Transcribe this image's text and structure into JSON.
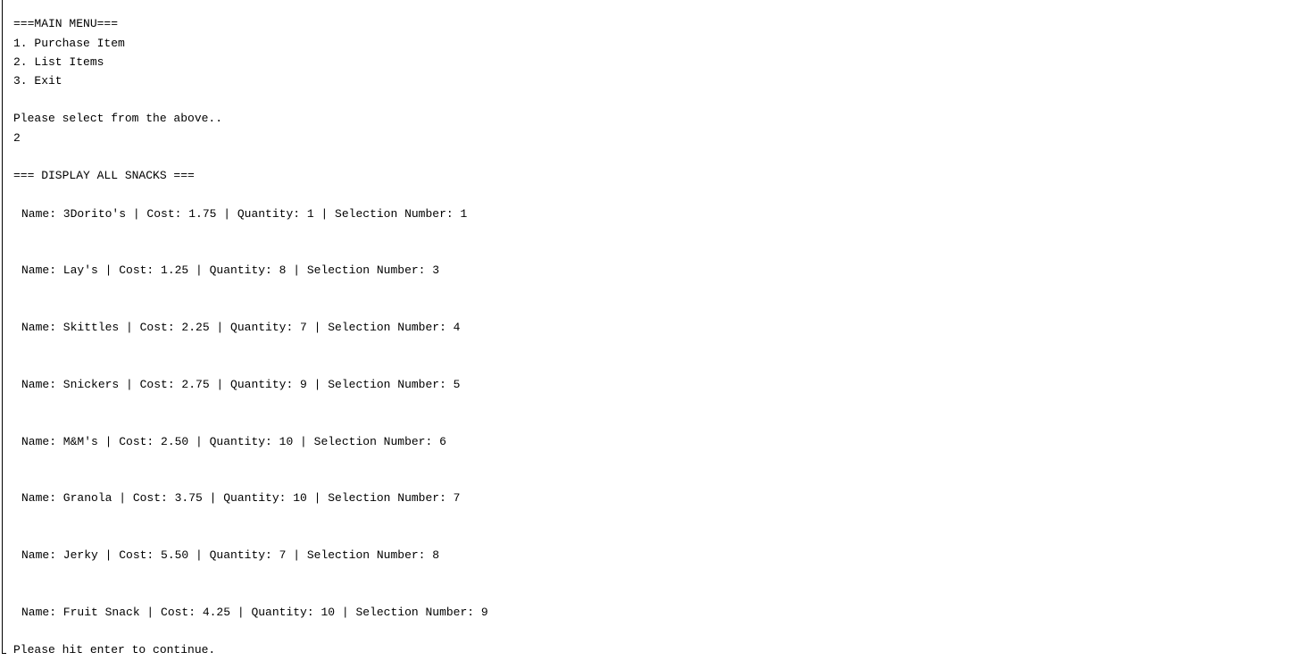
{
  "menu": {
    "header": "===MAIN MENU===",
    "options": [
      "1. Purchase Item",
      "2. List Items",
      "3. Exit"
    ]
  },
  "prompt": "Please select from the above..",
  "user_input": "2",
  "section_header": "=== DISPLAY ALL SNACKS ===",
  "snacks": [
    "Name: 3Dorito's | Cost: 1.75 | Quantity: 1 | Selection Number: 1",
    "Name: Lay's | Cost: 1.25 | Quantity: 8 | Selection Number: 3",
    "Name: Skittles | Cost: 2.25 | Quantity: 7 | Selection Number: 4",
    "Name: Snickers | Cost: 2.75 | Quantity: 9 | Selection Number: 5",
    "Name: M&M's | Cost: 2.50 | Quantity: 10 | Selection Number: 6",
    "Name: Granola | Cost: 3.75 | Quantity: 10 | Selection Number: 7",
    "Name: Jerky | Cost: 5.50 | Quantity: 7 | Selection Number: 8",
    "Name: Fruit Snack | Cost: 4.25 | Quantity: 10 | Selection Number: 9"
  ],
  "footer_prompt": "Please hit enter to continue."
}
